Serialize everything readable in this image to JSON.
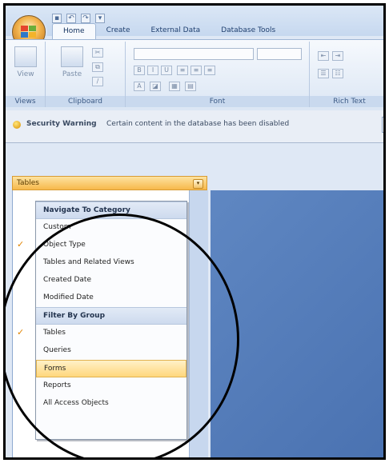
{
  "tabs": [
    "Home",
    "Create",
    "External Data",
    "Database Tools"
  ],
  "ribbon": {
    "groups": [
      {
        "label": "Views"
      },
      {
        "label": "Clipboard"
      },
      {
        "label": "Font"
      },
      {
        "label": "Rich Text"
      }
    ],
    "buttons": {
      "view": "View",
      "paste": "Paste"
    }
  },
  "security_bar": {
    "title": "Security Warning",
    "message": "Certain content in the database has been disabled"
  },
  "nav_pane": {
    "title": "Tables",
    "menu": [
      {
        "type": "header",
        "label": "Navigate To Category"
      },
      {
        "type": "item",
        "label": "Custom",
        "checked": false
      },
      {
        "type": "item",
        "label": "Object Type",
        "checked": true
      },
      {
        "type": "item",
        "label": "Tables and Related Views",
        "checked": false
      },
      {
        "type": "item",
        "label": "Created Date",
        "checked": false
      },
      {
        "type": "item",
        "label": "Modified Date",
        "checked": false
      },
      {
        "type": "header",
        "label": "Filter By Group"
      },
      {
        "type": "item",
        "label": "Tables",
        "checked": true
      },
      {
        "type": "item",
        "label": "Queries",
        "checked": false
      },
      {
        "type": "item",
        "label": "Forms",
        "checked": false,
        "highlighted": true
      },
      {
        "type": "item",
        "label": "Reports",
        "checked": false
      },
      {
        "type": "item",
        "label": "All Access Objects",
        "checked": false
      }
    ]
  },
  "colors": {
    "ribbon_blue": "#dfe8f5",
    "nav_header_orange": "#f7b84b",
    "workspace_blue": "#5077b6",
    "highlight_yellow": "#ffd77c",
    "check_orange": "#e08300"
  }
}
